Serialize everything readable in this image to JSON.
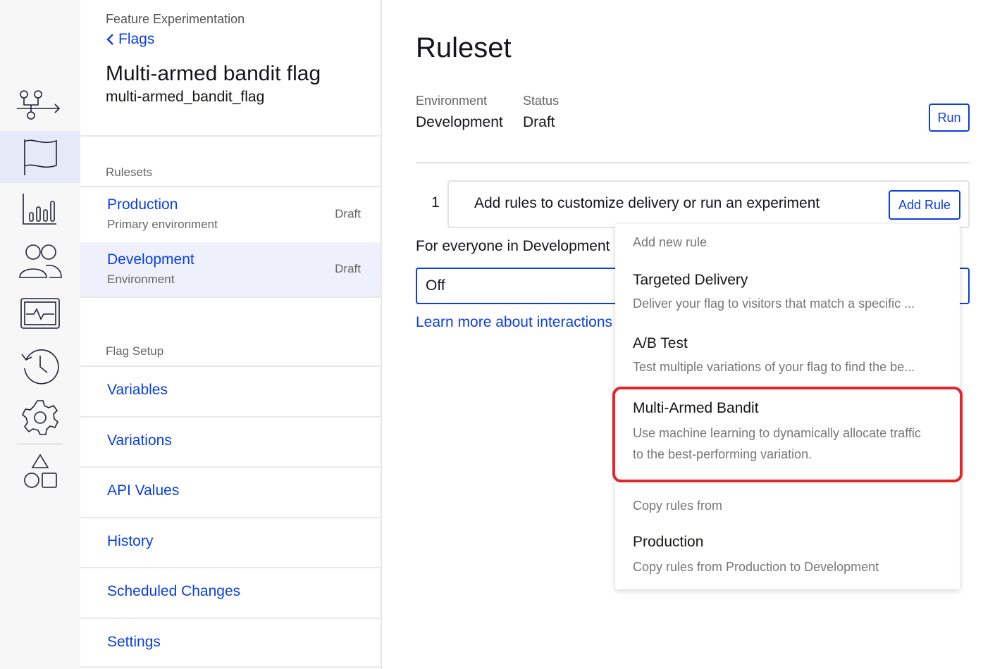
{
  "rail": {
    "items": [
      {
        "icon": "flow-icon"
      },
      {
        "icon": "flag-icon",
        "active": true
      },
      {
        "icon": "bar-chart-icon"
      },
      {
        "icon": "users-icon"
      },
      {
        "icon": "monitor-pulse-icon"
      },
      {
        "icon": "history-icon"
      },
      {
        "icon": "gear-icon"
      },
      {
        "icon": "shapes-icon"
      }
    ]
  },
  "sidebar": {
    "breadcrumb": "Feature Experimentation",
    "back_label": "Flags",
    "flag_name": "Multi-armed bandit flag",
    "flag_key": "multi-armed_bandit_flag",
    "rulesets_label": "Rulesets",
    "rulesets": [
      {
        "name": "Production",
        "sub": "Primary environment",
        "state": "Draft"
      },
      {
        "name": "Development",
        "sub": "Environment",
        "state": "Draft",
        "active": true
      }
    ],
    "setup_label": "Flag Setup",
    "setup_items": [
      "Variables",
      "Variations",
      "API Values",
      "History",
      "Scheduled Changes",
      "Settings"
    ]
  },
  "main": {
    "title": "Ruleset",
    "environment_label": "Environment",
    "environment_value": "Development",
    "status_label": "Status",
    "status_value": "Draft",
    "run_label": "Run",
    "rule_number": "1",
    "rule_text": "Add rules to customize delivery or run an experiment",
    "add_rule_label": "Add Rule",
    "everyone_text": "For everyone in Development",
    "select_value": "Off",
    "learn_more": "Learn more about interactions"
  },
  "menu": {
    "add_header": "Add new rule",
    "options": [
      {
        "title": "Targeted Delivery",
        "desc": "Deliver your flag to visitors that match a specific ..."
      },
      {
        "title": "A/B Test",
        "desc": "Test multiple variations of your flag to find the be..."
      },
      {
        "title": "Multi-Armed Bandit",
        "desc1": "Use machine learning to dynamically allocate traffic",
        "desc2": "to the best-performing variation."
      }
    ],
    "copy_header": "Copy rules from",
    "copy_option": {
      "title": "Production",
      "desc": "Copy rules from Production to Development"
    },
    "highlight_color": "#e0272c"
  },
  "colors": {
    "accent": "#0b3ee0",
    "active_bg": "#eef0fb"
  }
}
